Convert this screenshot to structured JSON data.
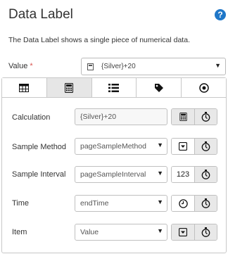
{
  "header": {
    "title": "Data Label",
    "help_glyph": "?",
    "description": "The Data Label shows a single piece of numerical data."
  },
  "value_field": {
    "label": "Value",
    "required_marker": "*",
    "selected": "{Silver}+20"
  },
  "tabs": [
    {
      "icon": "table-icon",
      "active": false
    },
    {
      "icon": "calculator-icon",
      "active": true
    },
    {
      "icon": "list-icon",
      "active": false
    },
    {
      "icon": "tag-icon",
      "active": false
    },
    {
      "icon": "target-icon",
      "active": false
    }
  ],
  "rows": {
    "calculation": {
      "label": "Calculation",
      "value": "{Silver}+20"
    },
    "sample_method": {
      "label": "Sample Method",
      "value": "pageSampleMethod"
    },
    "sample_interval": {
      "label": "Sample Interval",
      "value": "pageSampleInterval",
      "badge": "123"
    },
    "time": {
      "label": "Time",
      "value": "endTime"
    },
    "item": {
      "label": "Item",
      "value": "Value"
    }
  },
  "colors": {
    "accent": "#1f77c8",
    "required": "#d9534f",
    "active_tab": "#e6e6e6"
  }
}
